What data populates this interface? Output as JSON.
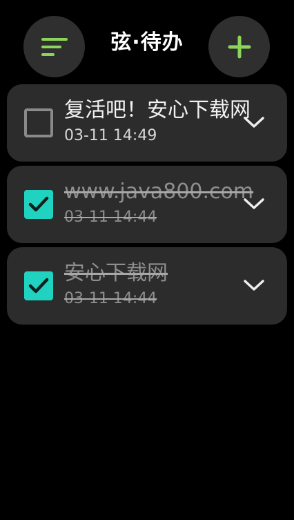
{
  "header": {
    "title": "弦·待办",
    "menu_icon": "sort-lines-icon",
    "add_icon": "plus-icon"
  },
  "colors": {
    "accent_green": "#8bd65a",
    "check_teal": "#1fd3c0",
    "card_bg": "#2c2c2c",
    "button_bg": "#2f2f2f"
  },
  "todos": [
    {
      "title": "复活吧！安心下载网",
      "time": "03-11 14:49",
      "done": false
    },
    {
      "title": "www.java800.com",
      "time": "03-11 14:44",
      "done": true
    },
    {
      "title": "安心下载网",
      "time": "03-11 14:44",
      "done": true
    }
  ]
}
